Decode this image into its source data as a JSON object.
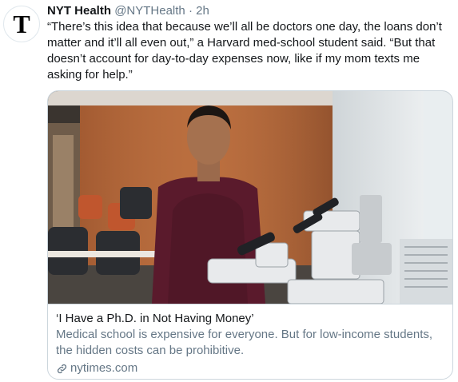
{
  "tweet": {
    "author_name": "NYT Health",
    "handle": "@NYTHealth",
    "separator": "·",
    "time": "2h",
    "text": "“There’s this idea that because we’ll all be doctors one day, the loans don’t\nmatter and it’ll all even out,” a Harvard med-school student said. “But that\ndoesn’t account for day-to-day expenses now, like if my mom texts me\nasking for help.”"
  },
  "card": {
    "title": "‘I Have a Ph.D. in Not Having Money’",
    "description": "Medical school is expensive for everyone. But for low-income students,\nthe hidden costs can be prohibitive.",
    "domain": "nytimes.com",
    "icon": "link-icon"
  },
  "avatar": {
    "icon": "nyt-logo-icon",
    "letter": "T"
  },
  "colors": {
    "text": "#14171a",
    "secondary": "#657786",
    "border": "#ccd6dd",
    "shirt": "#5a1a2c",
    "wall": "#b86a3b"
  }
}
